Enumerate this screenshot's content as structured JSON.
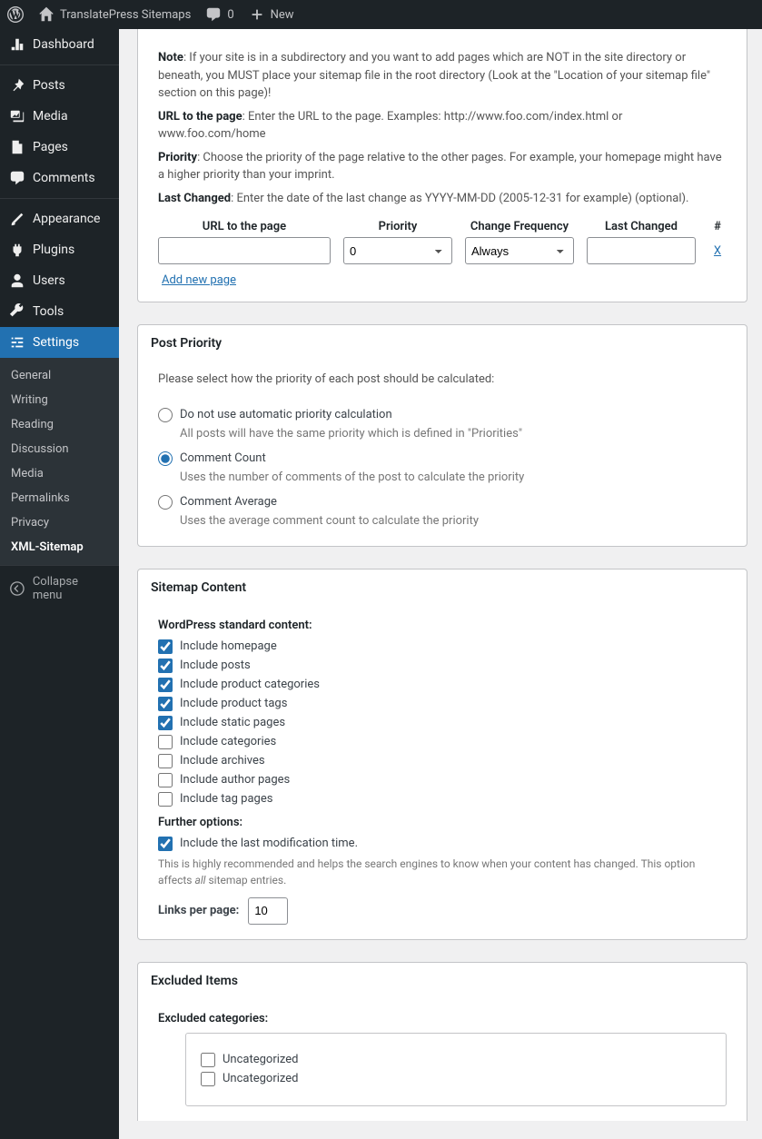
{
  "toolbar": {
    "site": "TranslatePress Sitemaps",
    "comments": "0",
    "new": "New"
  },
  "sidebar": {
    "dashboard": "Dashboard",
    "posts": "Posts",
    "media": "Media",
    "pages": "Pages",
    "comments": "Comments",
    "appearance": "Appearance",
    "plugins": "Plugins",
    "users": "Users",
    "tools": "Tools",
    "settings": "Settings",
    "collapse": "Collapse menu",
    "sub": {
      "general": "General",
      "writing": "Writing",
      "reading": "Reading",
      "discussion": "Discussion",
      "media": "Media",
      "permalinks": "Permalinks",
      "privacy": "Privacy",
      "xml": "XML-Sitemap"
    }
  },
  "top": {
    "note_b": "Note",
    "note": ": If your site is in a subdirectory and you want to add pages which are NOT in the site directory or beneath, you MUST place your sitemap file in the root directory (Look at the \"Location of your sitemap file\" section on this page)!",
    "url_b": "URL to the page",
    "url": ": Enter the URL to the page. Examples: http://www.foo.com/index.html or www.foo.com/home",
    "priority_b": "Priority",
    "priority": ": Choose the priority of the page relative to the other pages. For example, your homepage might have a higher priority than your imprint.",
    "lastchanged_b": "Last Changed",
    "lastchanged": ": Enter the date of the last change as YYYY-MM-DD (2005-12-31 for example) (optional).",
    "col_url": "URL to the page",
    "col_priority": "Priority",
    "col_freq": "Change Frequency",
    "col_last": "Last Changed",
    "col_hash": "#",
    "sel_priority": "0",
    "sel_freq": "Always",
    "delete": "X",
    "addnew": "Add new page"
  },
  "postpriority": {
    "title": "Post Priority",
    "intro": "Please select how the priority of each post should be calculated:",
    "opt1": "Do not use automatic priority calculation",
    "opt1_desc": "All posts will have the same priority which is defined in \"Priorities\"",
    "opt2": "Comment Count",
    "opt2_desc": "Uses the number of comments of the post to calculate the priority",
    "opt3": "Comment Average",
    "opt3_desc": "Uses the average comment count to calculate the priority"
  },
  "sitemap": {
    "title": "Sitemap Content",
    "std": "WordPress standard content:",
    "c1": "Include homepage",
    "c2": "Include posts",
    "c3": "Include product categories",
    "c4": "Include product tags",
    "c5": "Include static pages",
    "c6": "Include categories",
    "c7": "Include archives",
    "c8": "Include author pages",
    "c9": "Include tag pages",
    "further": "Further options:",
    "c10": "Include the last modification time.",
    "note_a": "This is highly recommended and helps the search engines to know when your content has changed. This option affects ",
    "note_i": "all",
    "note_b": " sitemap entries.",
    "links_label": "Links per page:",
    "links_val": "10"
  },
  "excluded": {
    "title": "Excluded Items",
    "subtitle": "Excluded categories:",
    "cat1": "Uncategorized",
    "cat2": "Uncategorized"
  }
}
